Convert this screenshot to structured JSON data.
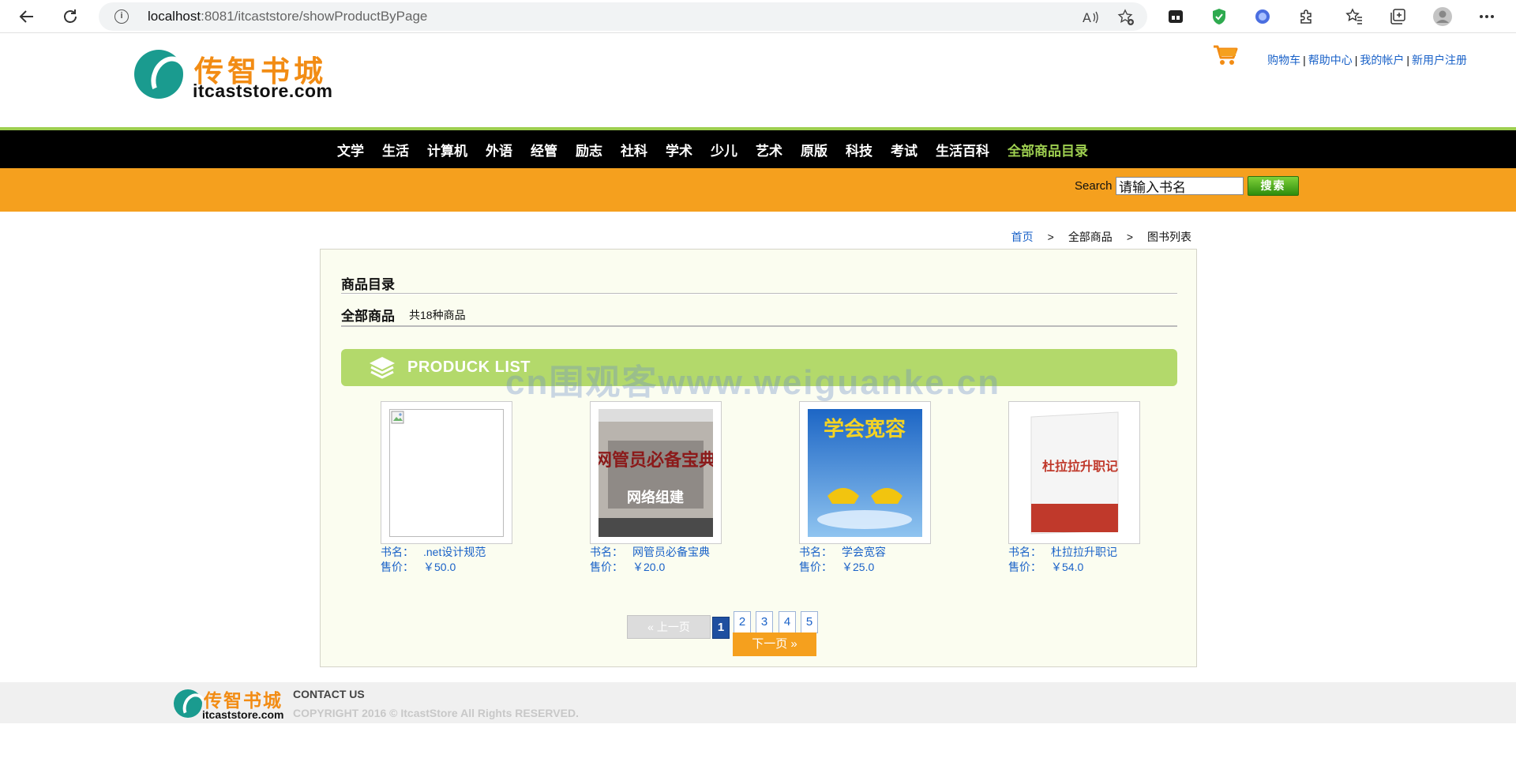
{
  "browser": {
    "url_host": "localhost",
    "url_rest": ":8081/itcaststore/showProductByPage"
  },
  "header": {
    "logo_cn": "传智书城",
    "logo_en": "itcaststore.com",
    "links": [
      {
        "label": "购物车"
      },
      {
        "label": "帮助中心"
      },
      {
        "label": "我的帐户"
      },
      {
        "label": "新用户注册"
      }
    ],
    "separator": "|"
  },
  "nav": {
    "items": [
      "文学",
      "生活",
      "计算机",
      "外语",
      "经管",
      "励志",
      "社科",
      "学术",
      "少儿",
      "艺术",
      "原版",
      "科技",
      "考试",
      "生活百科"
    ],
    "all_label": "全部商品目录"
  },
  "search": {
    "label": "Search",
    "value": "请输入书名",
    "button": "搜索"
  },
  "breadcrumb": {
    "home": "首页",
    "sep": ">",
    "level2": "全部商品",
    "level3": "图书列表"
  },
  "catalog": {
    "section_title": "商品目录",
    "all_title": "全部商品",
    "count_text": "共18种商品",
    "banner_text": "PRODUCK LIST"
  },
  "watermark": "cn围观客www.weiguanke.cn",
  "products": [
    {
      "name_label": "书名：",
      "name": ".net设计规范",
      "price_label": "售价：",
      "price": "￥50.0"
    },
    {
      "name_label": "书名：",
      "name": "网管员必备宝典",
      "price_label": "售价：",
      "price": "￥20.0",
      "cover_title": "网管员必备宝典",
      "cover_sub": "网络组建"
    },
    {
      "name_label": "书名：",
      "name": "学会宽容",
      "price_label": "售价：",
      "price": "￥25.0",
      "cover_title": "学会宽容"
    },
    {
      "name_label": "书名：",
      "name": "杜拉拉升职记",
      "price_label": "售价：",
      "price": "￥54.0",
      "cover_title": "杜拉拉升职记"
    }
  ],
  "pager": {
    "prev": "上一页",
    "pages": [
      "1",
      "2",
      "3",
      "4",
      "5"
    ],
    "current": "1",
    "next": "下一页"
  },
  "footer": {
    "logo_cn": "传智书城",
    "logo_en": "itcaststore.com",
    "contact": "CONTACT US",
    "copyright": "COPYRIGHT 2016 © ItcastStore All Rights RESERVED."
  },
  "colors": {
    "nav_bg": "#000000",
    "nav_accent": "#9ecf50",
    "search_bar": "#f5a01e",
    "link": "#1a62c8",
    "content_bg": "#fbfdf0"
  }
}
